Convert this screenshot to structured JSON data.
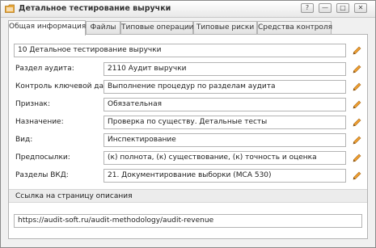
{
  "window": {
    "title": "Детальное тестирование выручки",
    "buttons": [
      "?",
      "—",
      "□",
      "✕"
    ]
  },
  "tabs": [
    "Общая информация",
    "Файлы",
    "Типовые операции",
    "Типовые риски",
    "Средства контроля"
  ],
  "general": {
    "name_value": "10 Детальное тестирование выручки",
    "fields": [
      {
        "label": "Раздел аудита:",
        "value": "2110 Аудит выручки"
      },
      {
        "label": "Контроль ключевой даты:",
        "value": "Выполнение процедур по разделам аудита"
      },
      {
        "label": "Признак:",
        "value": "Обязательная"
      },
      {
        "label": "Назначение:",
        "value": "Проверка по существу. Детальные тесты"
      },
      {
        "label": "Вид:",
        "value": "Инспектирование"
      },
      {
        "label": "Предпосылки:",
        "value": "(к) полнота, (к) существование, (к) точность и оценка"
      },
      {
        "label": "Разделы ВКД:",
        "value": "21. Документирование выборки (МСА 530)"
      }
    ],
    "link_section_title": "Ссылка на страницу описания",
    "link_value": "https://audit-soft.ru/audit-methodology/audit-revenue"
  },
  "colors": {
    "pencil_body": "#f0a030",
    "pencil_tip": "#7a4a10",
    "app_icon": "#e8a83a"
  }
}
